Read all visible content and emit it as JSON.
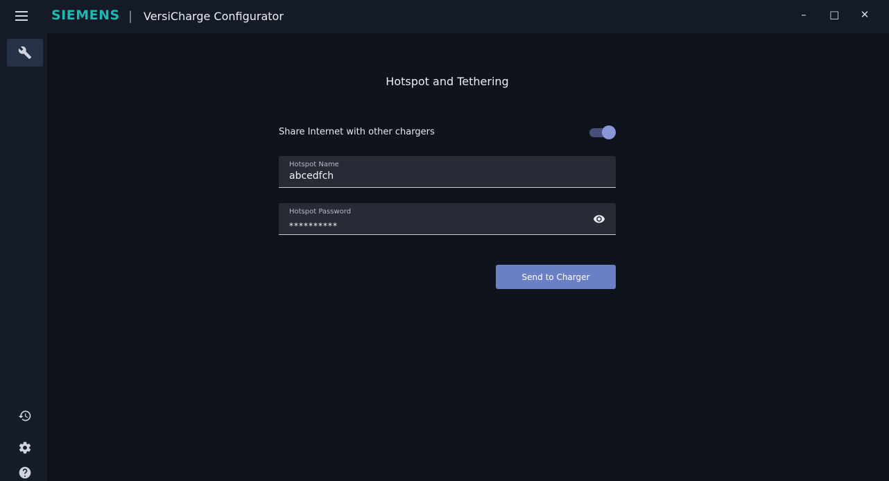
{
  "titlebar": {
    "brand": "SIEMENS",
    "separator": "|",
    "app_title": "VersiCharge Configurator",
    "minimize_glyph": "–",
    "maximize_glyph": "□",
    "close_glyph": "✕"
  },
  "sidebar": {
    "items": [
      {
        "icon": "wrench-icon",
        "active": true
      },
      {
        "icon": "history-icon",
        "active": false
      },
      {
        "icon": "gear-icon",
        "active": false
      },
      {
        "icon": "help-icon",
        "active": false
      }
    ]
  },
  "main": {
    "title": "Hotspot and Tethering",
    "share_toggle": {
      "label": "Share Internet with other chargers",
      "enabled": true
    },
    "hotspot_name": {
      "label": "Hotspot Name",
      "value": "abcedfch"
    },
    "hotspot_password": {
      "label": "Hotspot Password",
      "value": "**********"
    },
    "send_button": "Send to Charger"
  },
  "colors": {
    "brand": "#1bb9b3",
    "accent": "#6b7fc4",
    "background": "#0f131c",
    "sidebar": "#161c29"
  }
}
